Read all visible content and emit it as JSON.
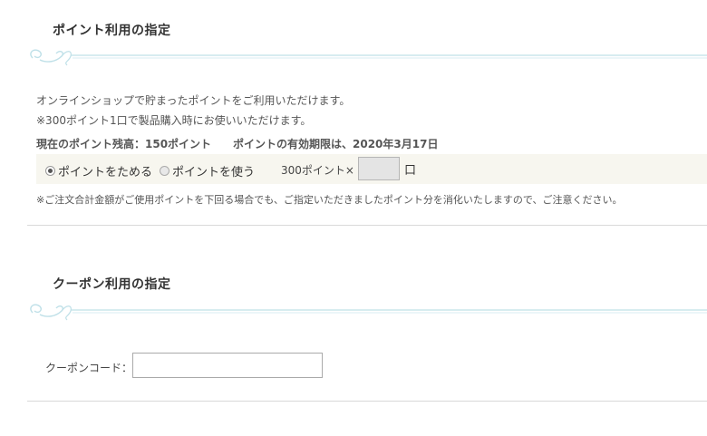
{
  "points_section": {
    "title": "ポイント利用の指定",
    "desc1": "オンラインショップで貯まったポイントをご利用いただけます。",
    "desc2": "※300ポイント1口で製品購入時にお使いいただけます。",
    "balance": "現在のポイント残高：150ポイント",
    "expiry": "ポイントの有効期限は、2020年3月17日",
    "option_save": "ポイントをためる",
    "option_use": "ポイントを使う",
    "selected": "ポイントをためる",
    "per_unit_label": "300ポイント×",
    "unit": "口",
    "note": "※ご注文合計金額がご使用ポイントを下回る場合でも、ご指定いただきましたポイント分を消化いたしますので、ご注意ください。"
  },
  "coupon_section": {
    "title": "クーポン利用の指定",
    "code_label": "クーポンコード：",
    "code_value": ""
  },
  "colors": {
    "ornament": "#bfe0e8",
    "row_bg": "#f7f6ef"
  }
}
